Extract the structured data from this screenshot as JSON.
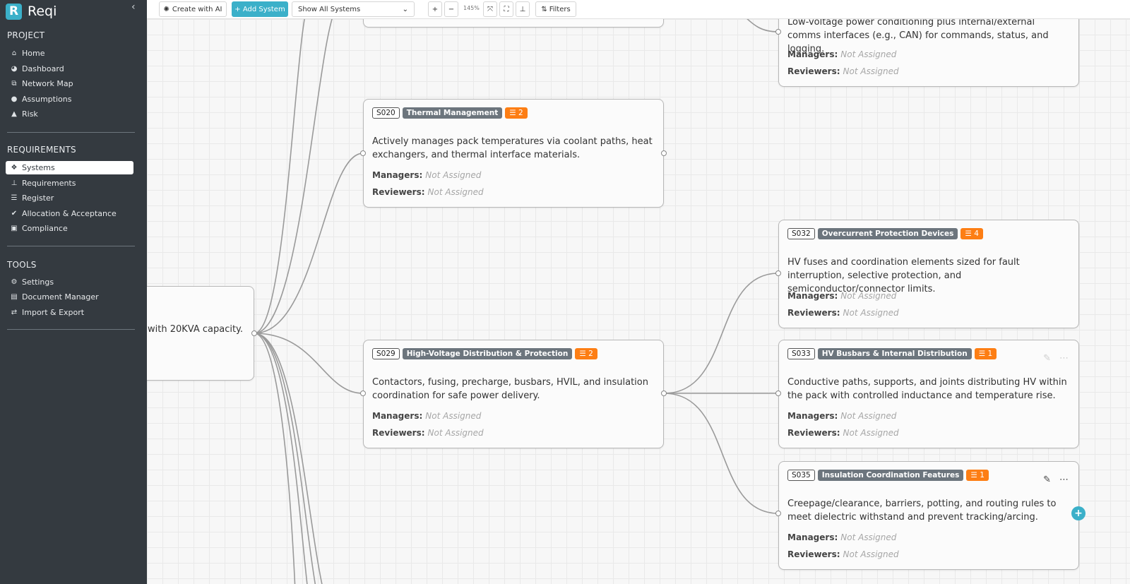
{
  "app": {
    "name": "Reqi",
    "logo_letter": "R",
    "collapse_icon": "chevron-left-icon"
  },
  "sidebar": {
    "project_title": "PROJECT",
    "project_items": [
      {
        "label": "Home",
        "icon": "home-icon"
      },
      {
        "label": "Dashboard",
        "icon": "dashboard-icon"
      },
      {
        "label": "Network Map",
        "icon": "network-icon"
      },
      {
        "label": "Assumptions",
        "icon": "lightbulb-icon"
      },
      {
        "label": "Risk",
        "icon": "warning-icon"
      }
    ],
    "requirements_title": "REQUIREMENTS",
    "requirements_items": [
      {
        "label": "Systems",
        "icon": "cubes-icon",
        "active": true
      },
      {
        "label": "Requirements",
        "icon": "sitemap-icon"
      },
      {
        "label": "Register",
        "icon": "list-icon"
      },
      {
        "label": "Allocation & Acceptance",
        "icon": "check-double-icon"
      },
      {
        "label": "Compliance",
        "icon": "clipboard-check-icon"
      }
    ],
    "tools_title": "TOOLS",
    "tools_items": [
      {
        "label": "Settings",
        "icon": "gear-icon"
      },
      {
        "label": "Document Manager",
        "icon": "file-icon"
      },
      {
        "label": "Import & Export",
        "icon": "exchange-icon"
      }
    ]
  },
  "toolbar": {
    "create_ai": "Create with AI",
    "add_system": "+ Add System",
    "filter_select": "Show All Systems",
    "zoom_in": "+",
    "zoom_out": "−",
    "zoom_level": "145%",
    "filters": "Filters"
  },
  "canvas": {
    "root_fragment": "with 20KVA capacity.",
    "top_right_desc": "Low-voltage power conditioning plus internal/external comms interfaces (e.g., CAN) for commands, status, and logging.",
    "managers_label": "Managers:",
    "reviewers_label": "Reviewers:",
    "not_assigned": "Not Assigned",
    "nodes": [
      {
        "code": "S020",
        "name": "Thermal Management",
        "count": "2",
        "desc": "Actively manages pack temperatures via coolant paths, heat exchangers, and thermal interface materials."
      },
      {
        "code": "S029",
        "name": "High-Voltage Distribution & Protection",
        "count": "2",
        "desc": "Contactors, fusing, precharge, busbars, HVIL, and insulation coordination for safe power delivery."
      },
      {
        "code": "S032",
        "name": "Overcurrent Protection Devices",
        "count": "4",
        "desc": "HV fuses and coordination elements sized for fault interruption, selective protection, and semiconductor/connector limits."
      },
      {
        "code": "S033",
        "name": "HV Busbars & Internal Distribution",
        "count": "1",
        "desc": "Conductive paths, supports, and joints distributing HV within the pack with controlled inductance and temperature rise."
      },
      {
        "code": "S035",
        "name": "Insulation Coordination Features",
        "count": "1",
        "desc": "Creepage/clearance, barriers, potting, and routing rules to meet dielectric withstand and prevent tracking/arcing."
      }
    ]
  },
  "colors": {
    "sidebar_bg": "#343a40",
    "accent": "#3bb0c9",
    "badge_gray": "#6c757d",
    "badge_orange": "#fd7e14"
  }
}
